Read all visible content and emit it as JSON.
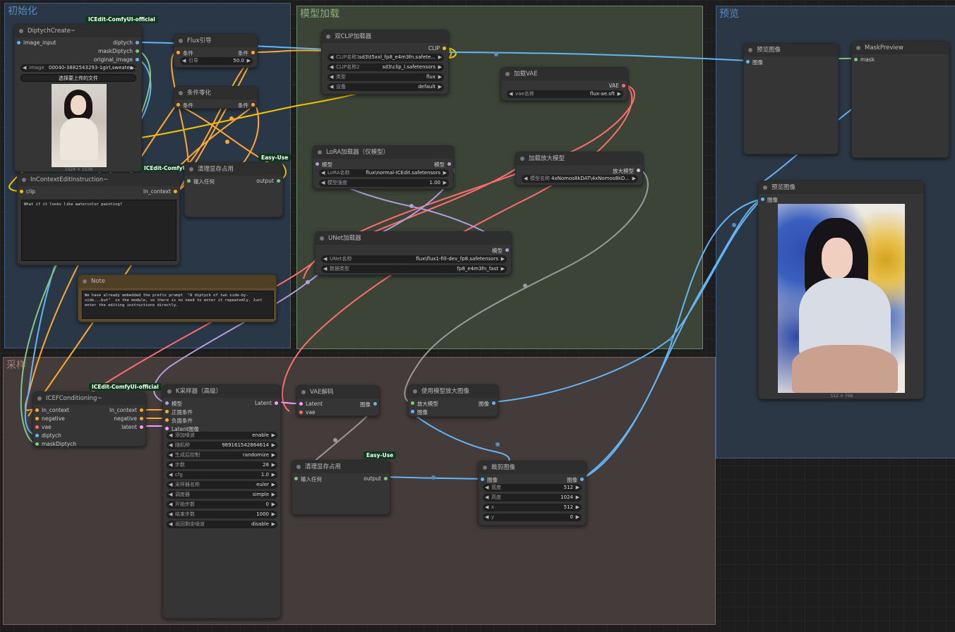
{
  "groups": {
    "init": "初始化",
    "model_load": "模型加载",
    "preview": "预览",
    "sampling": "采样"
  },
  "badges": {
    "icedit": "ICEdit-ComfyUI-official",
    "easy_use": "Easy-Use"
  },
  "colors": {
    "clip": "#f5c400",
    "model": "#b39ddb",
    "vae": "#ff6e6e",
    "image": "#64b5f6",
    "latent": "#ff9cf9",
    "mask": "#81c784",
    "cond": "#ffa931",
    "upscale": "#c7c7c7"
  },
  "diptych_create": {
    "title": "DiptychCreate~",
    "in_image": "image_input",
    "out_diptych": "diptych",
    "out_mask": "maskDiptych",
    "out_orig": "original_image",
    "image_label": "image",
    "image_value": "00040-3882543293-1girl,sweater,...",
    "upload_button": "选择要上传的文件",
    "image_size": "1024 × 1536"
  },
  "flux_guidance": {
    "title": "Flux引导",
    "in": "条件",
    "out": "条件",
    "w_label": "引导",
    "w_value": "50.0"
  },
  "cond_zero": {
    "title": "条件零化",
    "in": "条件",
    "out": "条件"
  },
  "dual_clip": {
    "title": "双CLIP加载器",
    "out": "CLIP",
    "w1_label": "CLIP名称1",
    "w1_value": "sd3\\t5xxl_fp8_e4m3fn.safete...",
    "w2_label": "CLIP名称2",
    "w2_value": "sd3\\clip_l.safetensors",
    "w3_label": "类型",
    "w3_value": "flux",
    "w4_label": "设备",
    "w4_value": "default"
  },
  "load_vae": {
    "title": "加载VAE",
    "out": "VAE",
    "w_label": "vae名称",
    "w_value": "flux-ae.sft"
  },
  "lora": {
    "title": "LoRA加载器（仅模型）",
    "in": "模型",
    "out": "模型",
    "w1_label": "LoRA名称",
    "w1_value": "flux\\normal-ICEdit.safetensors",
    "w2_label": "模型强度",
    "w2_value": "1.00"
  },
  "upscale_loader": {
    "title": "加载放大模型",
    "out": "放大模型",
    "w_label": "模型名称",
    "w_value": "4xNomos8kDAT\\4xNomos8kD..."
  },
  "unet": {
    "title": "UNet加载器",
    "out": "模型",
    "w1_label": "UNet名称",
    "w1_value": "flux\\flux1-fill-dev_fp8.safetensors",
    "w2_label": "数据类型",
    "w2_value": "fp8_e4m3fn_fast"
  },
  "instruction": {
    "title": "InContextEditInstruction~",
    "in": "clip",
    "out": "In_context",
    "text": "What if it looks like watercolor painting?"
  },
  "clean_top": {
    "title": "清理显存占用",
    "in": "输入任何",
    "out": "output"
  },
  "note": {
    "title": "Note",
    "text": "We have already embedded the prefix prompt  \"A diptych of two side-by-side...but\"  in the module, so there is no need to enter it repeatedly. Just enter the editing instructions directly."
  },
  "preview1": {
    "title": "预览图像",
    "in": "图像"
  },
  "mask_preview": {
    "title": "MaskPreview",
    "in": "mask"
  },
  "preview2": {
    "title": "预览图像",
    "in": "图像",
    "size": "512 × 768"
  },
  "icef": {
    "title": "ICEFConditioning~",
    "ins": [
      "In_context",
      "negative",
      "vae",
      "diptych",
      "maskDiptych"
    ],
    "outs": [
      "In_context",
      "negative",
      "latent"
    ]
  },
  "ksampler": {
    "title": "K采样器（高级）",
    "ins": [
      "模型",
      "正面条件",
      "负面条件",
      "Latent图像"
    ],
    "out": "Latent",
    "widgets": [
      [
        "添加噪波",
        "enable"
      ],
      [
        "随机种",
        "989161542864614"
      ],
      [
        "生成后控制",
        "randomize"
      ],
      [
        "步数",
        "28"
      ],
      [
        "cfg",
        "1.0"
      ],
      [
        "采样器名称",
        "euler"
      ],
      [
        "调度器",
        "simple"
      ],
      [
        "开始步数",
        "0"
      ],
      [
        "结束步数",
        "1000"
      ],
      [
        "返回剩余噪波",
        "disable"
      ]
    ]
  },
  "vae_decode": {
    "title": "VAE解码",
    "in1": "Latent",
    "in2": "vae",
    "out": "图像"
  },
  "upscale_image": {
    "title": "使用模型放大图像",
    "in1": "放大模型",
    "in2": "图像",
    "out": "图像"
  },
  "clean_bottom": {
    "title": "清理显存占用",
    "in": "输入任何",
    "out": "output"
  },
  "crop": {
    "title": "裁剪图像",
    "in": "图像",
    "out": "图像",
    "widgets": [
      [
        "宽度",
        "512"
      ],
      [
        "高度",
        "1024"
      ],
      [
        "x",
        "512"
      ],
      [
        "y",
        "0"
      ]
    ]
  }
}
